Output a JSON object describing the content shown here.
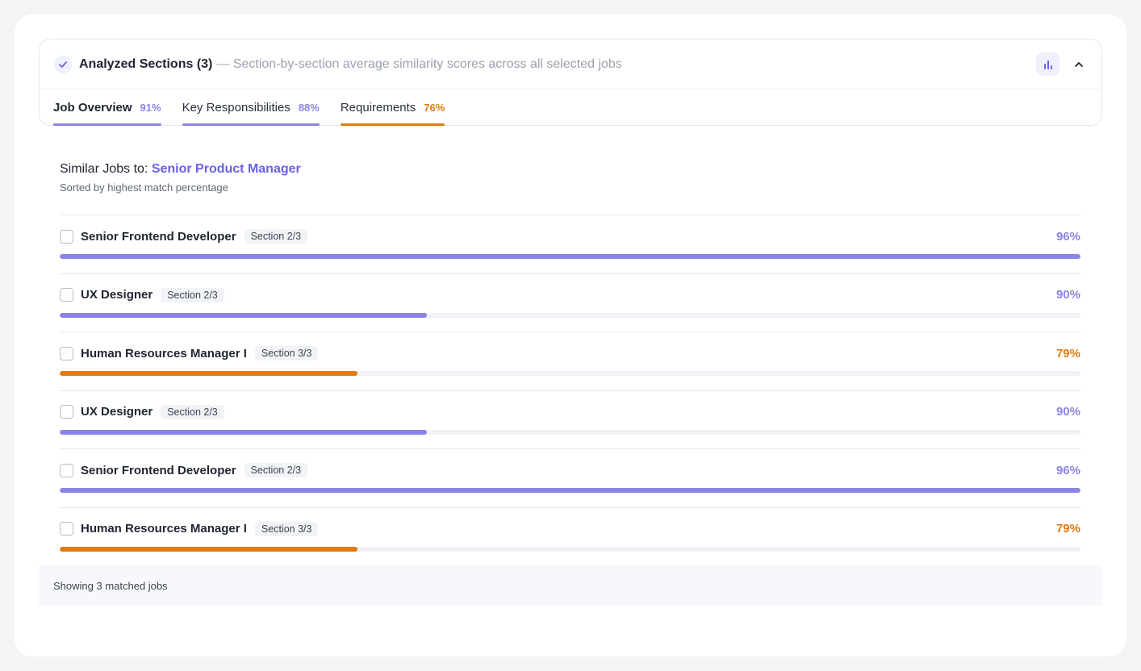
{
  "header": {
    "title": "Analyzed Sections (3)",
    "subtitle": "— Section-by-section average similarity scores across all selected jobs",
    "icons": {
      "status": "check-icon",
      "chart": "bar-chart-icon",
      "collapse": "chevron-up-icon"
    }
  },
  "tabs": [
    {
      "label": "Job Overview",
      "percent": "91%",
      "active": true,
      "color": "#8b84e6"
    },
    {
      "label": "Key Responsibilities",
      "percent": "88%",
      "active": false,
      "color": "#8b84e6"
    },
    {
      "label": "Requirements",
      "percent": "76%",
      "active": false,
      "color": "#e07b10"
    }
  ],
  "similar": {
    "prefix": "Similar Jobs to: ",
    "target": "Senior Product Manager",
    "sort_note": "Sorted by highest match percentage"
  },
  "jobs": [
    {
      "title": "Senior Frontend Developer",
      "section": "Section 2/3",
      "percent": "96%",
      "fill": 1.0,
      "color": "#8b84e6"
    },
    {
      "title": "UX Designer",
      "section": "Section 2/3",
      "percent": "90%",
      "fill": 0.36,
      "color": "#8b84e6"
    },
    {
      "title": "Human Resources Manager I",
      "section": "Section 3/3",
      "percent": "79%",
      "fill": 0.292,
      "color": "#e07b10"
    },
    {
      "title": "UX Designer",
      "section": "Section 2/3",
      "percent": "90%",
      "fill": 0.36,
      "color": "#8b84e6"
    },
    {
      "title": "Senior Frontend Developer",
      "section": "Section 2/3",
      "percent": "96%",
      "fill": 1.0,
      "color": "#8b84e6"
    },
    {
      "title": "Human Resources Manager I",
      "section": "Section 3/3",
      "percent": "79%",
      "fill": 0.292,
      "color": "#e07b10"
    }
  ],
  "footer": {
    "text": "Showing 3 matched jobs"
  },
  "colors": {
    "accent": "#6a60e8",
    "purple_bar": "#8b84e6",
    "orange": "#e07b10"
  }
}
